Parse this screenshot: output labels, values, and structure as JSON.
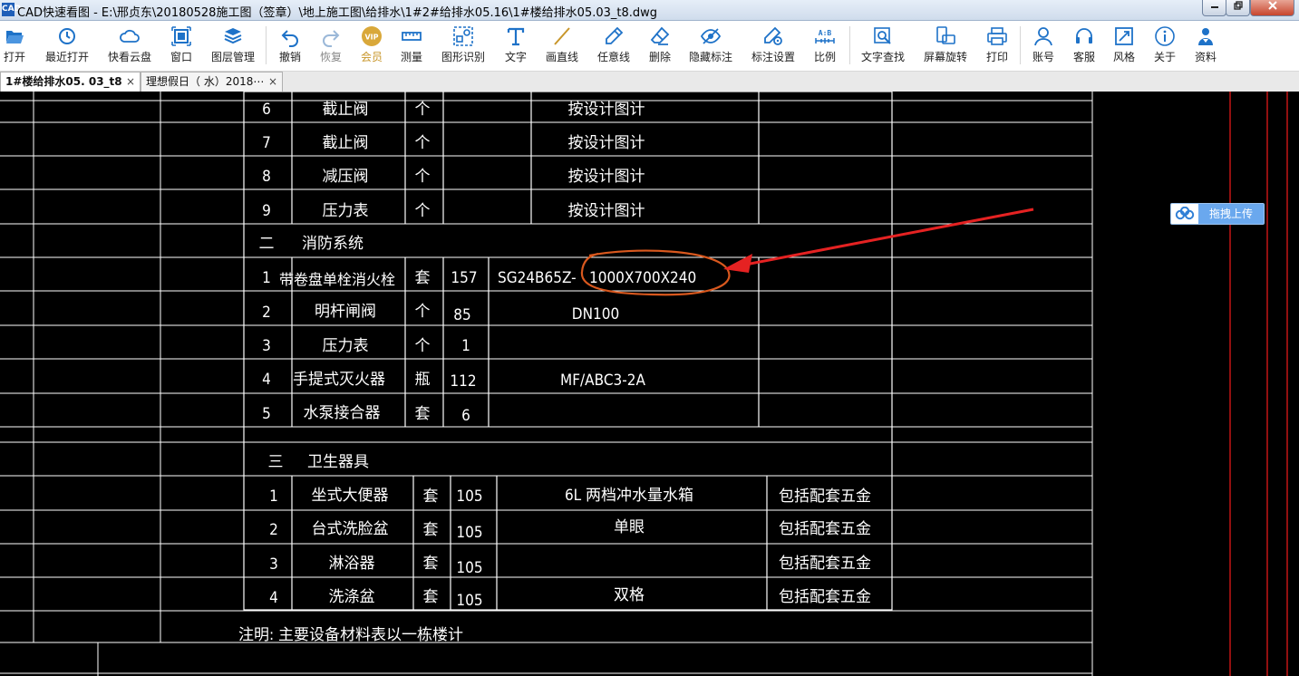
{
  "window": {
    "title": "CAD快速看图 - E:\\邢贞东\\20180528施工图（签章）\\地上施工图\\给排水\\1#2#给排水05.16\\1#楼给排水05.03_t8.dwg",
    "icon_text": "CAD"
  },
  "toolbar": {
    "buttons": [
      {
        "label": "打开",
        "icon": "folder-open-icon"
      },
      {
        "label": "最近打开",
        "icon": "clock-icon"
      },
      {
        "label": "快看云盘",
        "icon": "cloud-icon"
      },
      {
        "label": "窗口",
        "icon": "window-icon"
      },
      {
        "label": "图层管理",
        "icon": "layers-icon"
      },
      {
        "label": "撤销",
        "icon": "undo-icon"
      },
      {
        "label": "恢复",
        "icon": "redo-icon"
      },
      {
        "label": "会员",
        "icon": "vip-badge-icon",
        "badge": "VIP"
      },
      {
        "label": "测量",
        "icon": "ruler-icon"
      },
      {
        "label": "图形识别",
        "icon": "shape-recognize-icon"
      },
      {
        "label": "文字",
        "icon": "text-t-icon"
      },
      {
        "label": "画直线",
        "icon": "line-icon"
      },
      {
        "label": "任意线",
        "icon": "pen-icon"
      },
      {
        "label": "删除",
        "icon": "eraser-icon"
      },
      {
        "label": "隐藏标注",
        "icon": "eye-hidden-icon"
      },
      {
        "label": "标注设置",
        "icon": "annotation-settings-icon"
      },
      {
        "label": "比例",
        "icon": "scale-ab-icon",
        "badge": "A:B"
      },
      {
        "label": "文字查找",
        "icon": "text-search-icon"
      },
      {
        "label": "屏幕旋转",
        "icon": "rotate-screen-icon"
      },
      {
        "label": "打印",
        "icon": "printer-icon"
      },
      {
        "label": "账号",
        "icon": "user-icon"
      },
      {
        "label": "客服",
        "icon": "headset-icon"
      },
      {
        "label": "风格",
        "icon": "style-icon"
      },
      {
        "label": "关于",
        "icon": "info-icon"
      },
      {
        "label": "资料",
        "icon": "materials-icon"
      }
    ]
  },
  "tabs": [
    {
      "label": "1#楼给排水05. 03_t8",
      "close": "×",
      "active": true
    },
    {
      "label": "理想假日（ 水）2018⋯",
      "close": "×",
      "active": false
    }
  ],
  "upload_button": {
    "label": "拖拽上传",
    "icon": "cloud-upload-icon"
  },
  "table": {
    "section_rows": [
      {
        "no": "6",
        "name": "截止阀",
        "unit": "个",
        "qty": "",
        "spec": "按设计图计",
        "note": ""
      },
      {
        "no": "7",
        "name": "截止阀",
        "unit": "个",
        "qty": "",
        "spec": "按设计图计",
        "note": ""
      },
      {
        "no": "8",
        "name": "减压阀",
        "unit": "个",
        "qty": "",
        "spec": "按设计图计",
        "note": ""
      },
      {
        "no": "9",
        "name": "压力表",
        "unit": "个",
        "qty": "",
        "spec": "按设计图计",
        "note": ""
      }
    ],
    "section2_title": {
      "no": "二",
      "name": "消防系统"
    },
    "section2_rows": [
      {
        "no": "1",
        "name": "带卷盘单栓消火栓",
        "unit": "套",
        "qty": "157",
        "spec_a": "SG24B65Z-",
        "spec_b": "1000X700X240",
        "note": ""
      },
      {
        "no": "2",
        "name": "明杆闸阀",
        "unit": "个",
        "qty": "85",
        "spec": "DN100",
        "note": ""
      },
      {
        "no": "3",
        "name": "压力表",
        "unit": "个",
        "qty": "1",
        "spec": "",
        "note": ""
      },
      {
        "no": "4",
        "name": "手提式灭火器",
        "unit": "瓶",
        "qty": "112",
        "spec": "MF/ABC3-2A",
        "note": ""
      },
      {
        "no": "5",
        "name": "水泵接合器",
        "unit": "套",
        "qty": "6",
        "spec": "",
        "note": ""
      }
    ],
    "section3_title": {
      "no": "三",
      "name": "卫生器具"
    },
    "section3_rows": [
      {
        "no": "1",
        "name": "坐式大便器",
        "unit": "套",
        "qty": "105",
        "spec": "6L 两档冲水量水箱",
        "note": "包括配套五金"
      },
      {
        "no": "2",
        "name": "台式洗脸盆",
        "unit": "套",
        "qty": "105",
        "spec": "单眼",
        "note": "包括配套五金"
      },
      {
        "no": "3",
        "name": "淋浴器",
        "unit": "套",
        "qty": "105",
        "spec": "",
        "note": "包括配套五金"
      },
      {
        "no": "4",
        "name": "洗涤盆",
        "unit": "套",
        "qty": "105",
        "spec": "双格",
        "note": "包括配套五金"
      }
    ],
    "footnote": "注明: 主要设备材料表以一栋楼计"
  },
  "colors": {
    "canvas_bg": "#000000",
    "grid_line": "#ffffff",
    "red_frame": "#e01818",
    "annotation_orange": "#d9581e",
    "annotation_arrow": "#e52222",
    "icon_blue": "#1e72c8"
  }
}
